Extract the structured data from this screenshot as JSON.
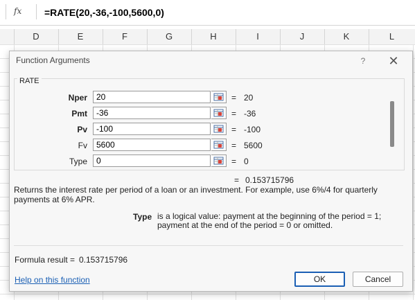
{
  "formula_bar": {
    "fx_label": "fx",
    "formula": "=RATE(20,-36,-100,5600,0)"
  },
  "columns": [
    "D",
    "E",
    "F",
    "G",
    "H",
    "I",
    "J",
    "K",
    "L"
  ],
  "dialog": {
    "title": "Function Arguments",
    "help_symbol": "?",
    "close_symbol": "✕",
    "function_name": "RATE",
    "args": [
      {
        "label": "Nper",
        "bold": true,
        "value": "20",
        "result": "20"
      },
      {
        "label": "Pmt",
        "bold": true,
        "value": "-36",
        "result": "-36"
      },
      {
        "label": "Pv",
        "bold": true,
        "value": "-100",
        "result": "-100"
      },
      {
        "label": "Fv",
        "bold": false,
        "value": "5600",
        "result": "5600"
      },
      {
        "label": "Type",
        "bold": false,
        "value": "0",
        "result": "0"
      }
    ],
    "equals": "=",
    "function_result": "0.153715796",
    "description": "Returns the interest rate per period of a loan or an investment. For example, use 6%/4 for quarterly payments at 6% APR.",
    "arg_help_term": "Type",
    "arg_help_text_1": "is a logical value: payment at the beginning of the period = 1;",
    "arg_help_text_2": "payment at the end of the period = 0 or omitted.",
    "formula_result_label": "Formula result =",
    "formula_result_value": "0.153715796",
    "help_link": "Help on this function",
    "ok_label": "OK",
    "cancel_label": "Cancel"
  }
}
